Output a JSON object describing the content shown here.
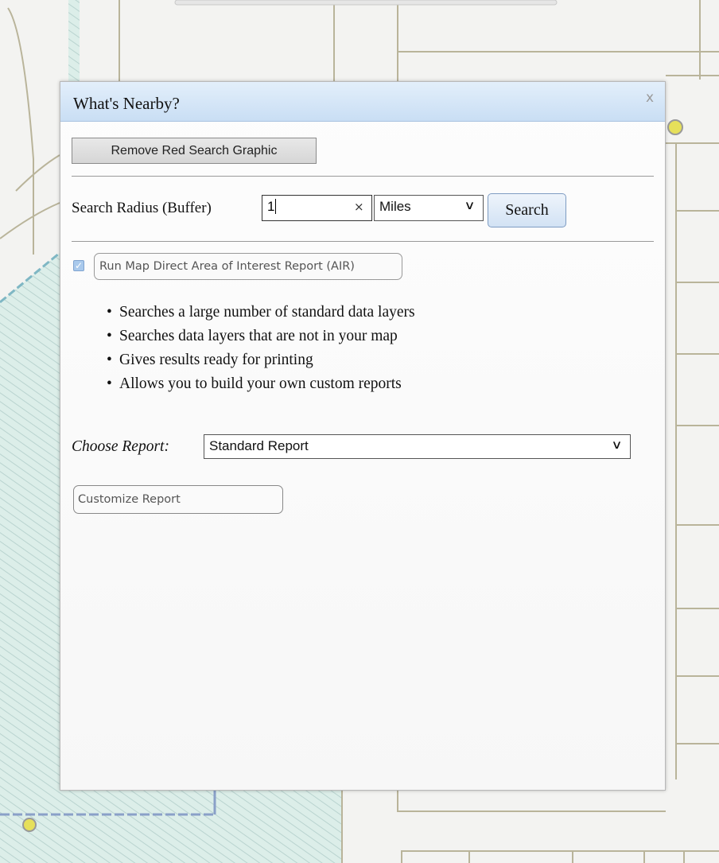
{
  "dialog": {
    "title": "What's Nearby?",
    "close_glyph": "x",
    "remove_button_label": "Remove Red Search Graphic",
    "radius": {
      "label": "Search Radius (Buffer)",
      "value": "1",
      "clear_glyph": "×",
      "unit": "Miles",
      "search_label": "Search"
    },
    "air": {
      "checked": true,
      "label": "Run Map Direct Area of Interest Report (AIR)"
    },
    "bullets": [
      "Searches a large number of standard data layers",
      "Searches data layers that are not in your map",
      "Gives results ready for printing",
      "Allows you to build your own custom reports"
    ],
    "report": {
      "label": "Choose Report:",
      "selected": "Standard Report"
    },
    "customize_label": "Customize Report"
  },
  "icons": {
    "close": "close-icon",
    "clear": "clear-icon",
    "dropdown": "chevron-down-icon",
    "checkbox": "checkmark-icon",
    "map_marker": "map-marker-icon"
  },
  "colors": {
    "titlebar": "#c9def4",
    "parcel_line": "#b9b49a",
    "hatch_area": "#d7ebe6",
    "boundary": "#7fb7c4",
    "marker": "#e6e05a"
  }
}
